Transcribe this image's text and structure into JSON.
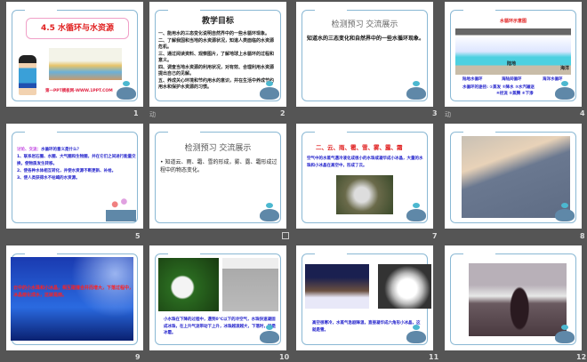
{
  "slides": [
    {
      "num": "1",
      "title": "4.5 水循环与水资源",
      "footer": "第一PPT模板网-WWW.1PPT.COM"
    },
    {
      "num": "2",
      "title": "教学目标",
      "items": [
        "一、能用水的三态变化说明自然界中的一些水循环现象。",
        "二、了解我国和当地的水资源状况，知道人类面临的水资源危机。",
        "三、通过阅读资料、观察图片，了解地球上水循环的过程和意义。",
        "四、调查当地水资源的利用状况，对有效、合理利用水资源提出自己的见解。",
        "五、养成关心环境和节约用水的意识，并在生活中养成节约用水和保护水资源的习惯。"
      ]
    },
    {
      "num": "3",
      "title": "检测预习  交流展示",
      "body": "知道水的三态变化和自然界中的一些水循环现象。"
    },
    {
      "num": "4",
      "title": "水循环示意图",
      "land": "陆地",
      "ocean": "海洋",
      "labels": [
        "陆地水循环",
        "海陆间循环",
        "海洋水循环"
      ],
      "routes1": "水循环的途径: ①蒸发 ②降水 ③水汽输送",
      "routes2": "④径流 ⑤蒸腾 ⑥下渗"
    },
    {
      "num": "5",
      "q_label": "讨论、交流：",
      "q": "水循环的意义是什么？",
      "items": [
        "1、联系岩石圈、水圈、大气圈和生物圈，并在它们之间进行能量交换，使物质发生转移。",
        "2、使各种水体相互转化，并使水资源不断更新、补给。",
        "3、使人类获得水不枯竭的水资源。"
      ]
    },
    {
      "num": "6",
      "title": "检测预习  交流展示",
      "body": "知道云、雨、霜、雪的形成，雾、露、霜形成过程中的物态变化。"
    },
    {
      "num": "7",
      "title": "二、云、雨、雹、雪、雾、露、霜",
      "body": "空气中的水蒸气遇冷液化成很小的水珠或凝华成小冰晶，大量的水珠和小冰晶在高空中，形成了云。"
    },
    {
      "num": "8"
    },
    {
      "num": "9",
      "body": "云中的小水珠和小冰晶，相互碰撞合并而增大，下落过程中，冰晶熔化成水，这就是雨。"
    },
    {
      "num": "10",
      "body": "小水珠在下降的过程中，遇到0℃以下的冷空气，水珠快速凝固成冰珠，在上升气流带动下上升，冰珠越滚越大，下落时，就是冰雹。"
    },
    {
      "num": "11",
      "body": "高空很寒冷，水蒸气急剧降温，直接凝华成六角形小冰晶，这就是雪。"
    },
    {
      "num": "12"
    }
  ],
  "anim_icon": "动"
}
